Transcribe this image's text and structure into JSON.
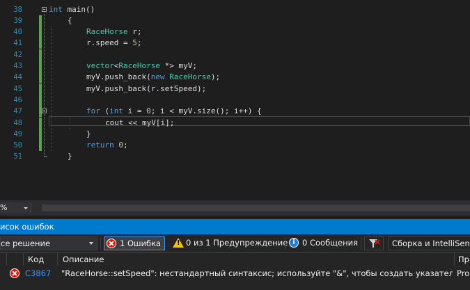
{
  "editor": {
    "lines": [
      {
        "num": "38",
        "tokens": [
          [
            "kw",
            "int"
          ],
          [
            "txt",
            " main()"
          ]
        ]
      },
      {
        "num": "39",
        "tokens": [
          [
            "txt",
            "{"
          ]
        ]
      },
      {
        "num": "40",
        "tokens": [
          [
            "ty",
            "RaceHorse"
          ],
          [
            "txt",
            " r;"
          ]
        ]
      },
      {
        "num": "41",
        "tokens": [
          [
            "txt",
            "r.speed = "
          ],
          [
            "num",
            "5"
          ],
          [
            "txt",
            ";"
          ]
        ]
      },
      {
        "num": "42",
        "tokens": []
      },
      {
        "num": "43",
        "tokens": [
          [
            "ty",
            "vector"
          ],
          [
            "txt",
            "<"
          ],
          [
            "ty",
            "RaceHorse"
          ],
          [
            "txt",
            " *> myV;"
          ]
        ]
      },
      {
        "num": "44",
        "tokens": [
          [
            "txt",
            "myV.push_back("
          ],
          [
            "kw",
            "new"
          ],
          [
            "txt",
            " "
          ],
          [
            "ty",
            "RaceHorse"
          ],
          [
            "txt",
            ");"
          ]
        ]
      },
      {
        "num": "45",
        "tokens": [
          [
            "txt",
            "myV.push_back(r.setSpeed);"
          ]
        ]
      },
      {
        "num": "46",
        "tokens": []
      },
      {
        "num": "47",
        "tokens": [
          [
            "kw",
            "for"
          ],
          [
            "txt",
            " ("
          ],
          [
            "kw",
            "int"
          ],
          [
            "txt",
            " i = "
          ],
          [
            "num",
            "0"
          ],
          [
            "txt",
            "; i < myV.size(); i++) {"
          ]
        ]
      },
      {
        "num": "48",
        "tokens": [
          [
            "txt",
            "cout << myV[i];"
          ]
        ]
      },
      {
        "num": "49",
        "tokens": [
          [
            "txt",
            "}"
          ]
        ]
      },
      {
        "num": "50",
        "tokens": [
          [
            "kw",
            "return"
          ],
          [
            "txt",
            " "
          ],
          [
            "num",
            "0"
          ],
          [
            "txt",
            ";"
          ]
        ]
      },
      {
        "num": "51",
        "tokens": [
          [
            "txt",
            "}"
          ]
        ]
      }
    ]
  },
  "zoom": {
    "value": "%"
  },
  "error_list": {
    "title": "исок ошибок",
    "scope": "се решение",
    "errors_filter": "1 Ошибка",
    "warnings_filter": "0 из 1 Предупреждение",
    "messages_filter": "0 Сообщения",
    "info_glyph": "i",
    "warn_glyph": "!",
    "build_source": "Сборка и IntelliSense",
    "columns": {
      "code": "Код",
      "description": "Описание",
      "project": "Пр"
    },
    "rows": [
      {
        "code": "C3867",
        "description": "\"RaceHorse::setSpeed\": нестандартный синтаксис; используйте \"&\", чтобы создать указатель на член",
        "project": "Pro"
      }
    ]
  },
  "colors": {
    "background": "#1e1e1e",
    "keyword": "#569cd6",
    "type": "#4ec9b0",
    "number": "#b5cea8",
    "line_number": "#2b91af",
    "panel_title": "#007acc",
    "error_code_link": "#3794ff"
  }
}
